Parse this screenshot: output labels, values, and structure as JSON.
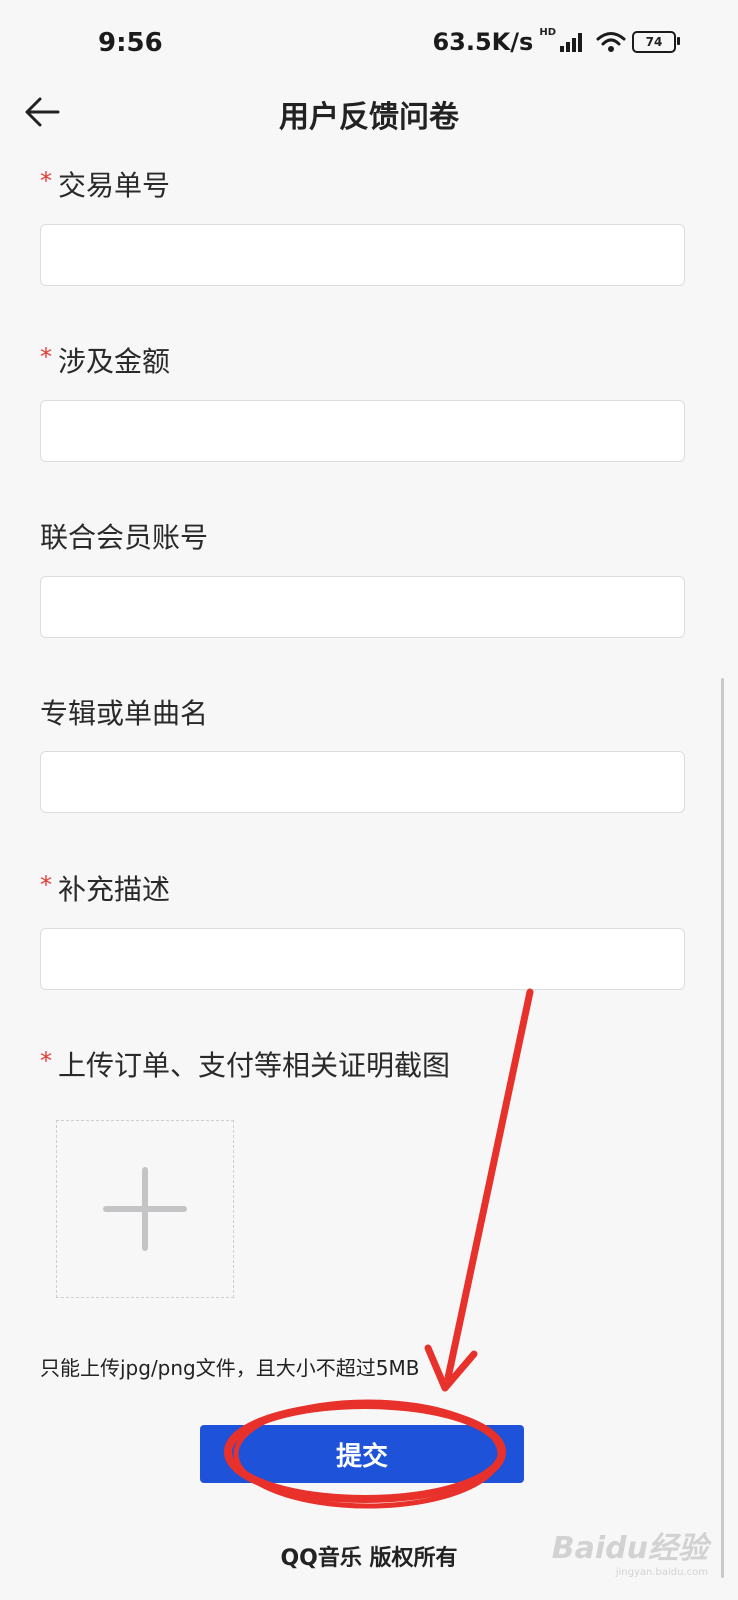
{
  "status_bar": {
    "time": "9:56",
    "net_speed": "63.5K/s",
    "hd_tag": "HD",
    "battery": "74"
  },
  "nav": {
    "title": "用户反馈问卷"
  },
  "form": {
    "fields": [
      {
        "label": "交易单号",
        "required": true,
        "value": ""
      },
      {
        "label": "涉及金额",
        "required": true,
        "value": ""
      },
      {
        "label": "联合会员账号",
        "required": false,
        "value": ""
      },
      {
        "label": "专辑或单曲名",
        "required": false,
        "value": ""
      },
      {
        "label": "补充描述",
        "required": true,
        "value": ""
      }
    ],
    "required_mark": "*",
    "upload": {
      "label": "上传订单、支付等相关证明截图",
      "required": true,
      "hint": "只能上传jpg/png文件，且大小不超过5MB"
    },
    "submit_label": "提交"
  },
  "footer": {
    "text": "QQ音乐 版权所有"
  },
  "watermark": {
    "text": "Baidu经验",
    "sub": "jingyan.baidu.com"
  },
  "colors": {
    "primary": "#1e52d9",
    "required": "#e53935",
    "annotation": "#e8312b"
  }
}
